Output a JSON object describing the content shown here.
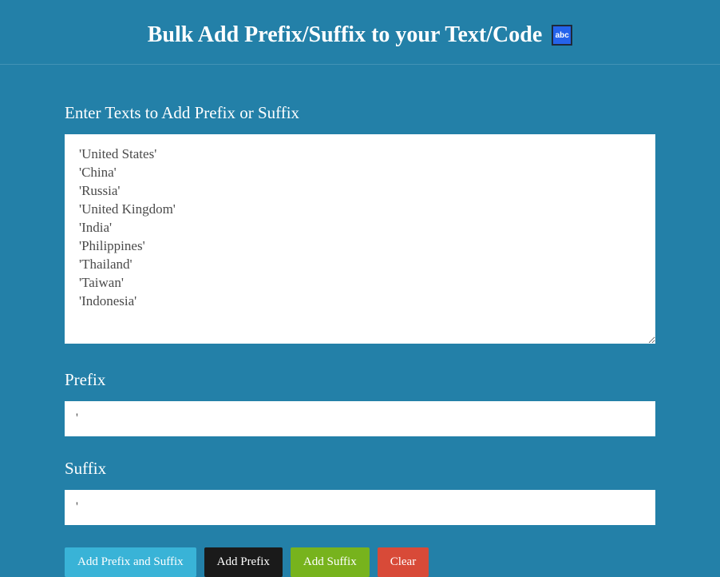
{
  "header": {
    "title": "Bulk Add Prefix/Suffix to your Text/Code",
    "icon_text": "abc"
  },
  "form": {
    "text_label": "Enter Texts to Add Prefix or Suffix",
    "text_value": "'United States'\n'China'\n'Russia'\n'United Kingdom'\n'India'\n'Philippines'\n'Thailand'\n'Taiwan'\n'Indonesia'",
    "prefix_label": "Prefix",
    "prefix_value": "'",
    "suffix_label": "Suffix",
    "suffix_value": "'"
  },
  "buttons": {
    "add_both": "Add Prefix and Suffix",
    "add_prefix": "Add Prefix",
    "add_suffix": "Add Suffix",
    "clear": "Clear"
  }
}
